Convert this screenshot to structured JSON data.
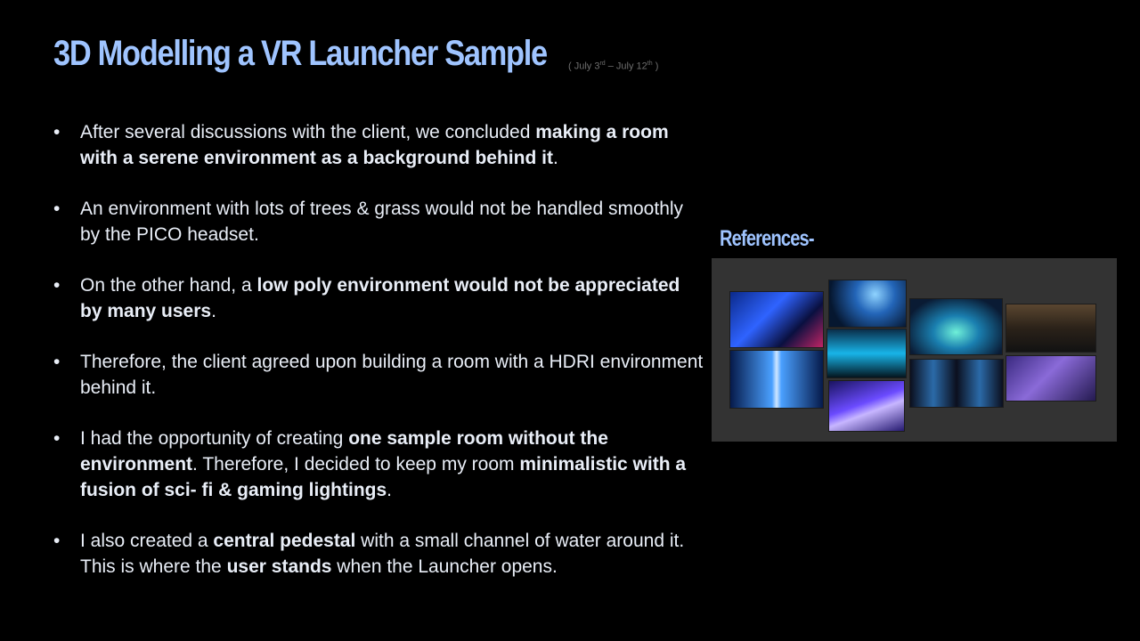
{
  "slide": {
    "title": "3D Modelling a VR Launcher Sample",
    "date": {
      "open": "( July 3",
      "sup1": "rd",
      "middle": " – July 12",
      "sup2": "th",
      "close": " )"
    },
    "bullet_marker": "•",
    "bullets": [
      {
        "t1": "After several discussions with the client, we concluded ",
        "b1": "making a room with a serene environment as a background behind it",
        "t2": "."
      },
      {
        "t1": "An environment with lots of trees & grass would not be handled smoothly by the PICO headset."
      },
      {
        "t1": "On the other hand, a ",
        "b1": "low poly environment would not be appreciated by many users",
        "t2": "."
      },
      {
        "t1": "Therefore, the client agreed upon building a room with a HDRI environment behind it."
      },
      {
        "t1": "I had the opportunity of creating ",
        "b1": "one sample room without the environment",
        "t2": ". Therefore, I decided to keep my room ",
        "b2": "minimalistic with a fusion of sci- fi & gaming lightings",
        "t3": "."
      },
      {
        "t1": "I also created a ",
        "b1": "central pedestal",
        "t2": " with a small channel of water around it. This is where the ",
        "b2": "user stands",
        "t3": " when the Launcher opens."
      }
    ],
    "references_label": "References-"
  }
}
